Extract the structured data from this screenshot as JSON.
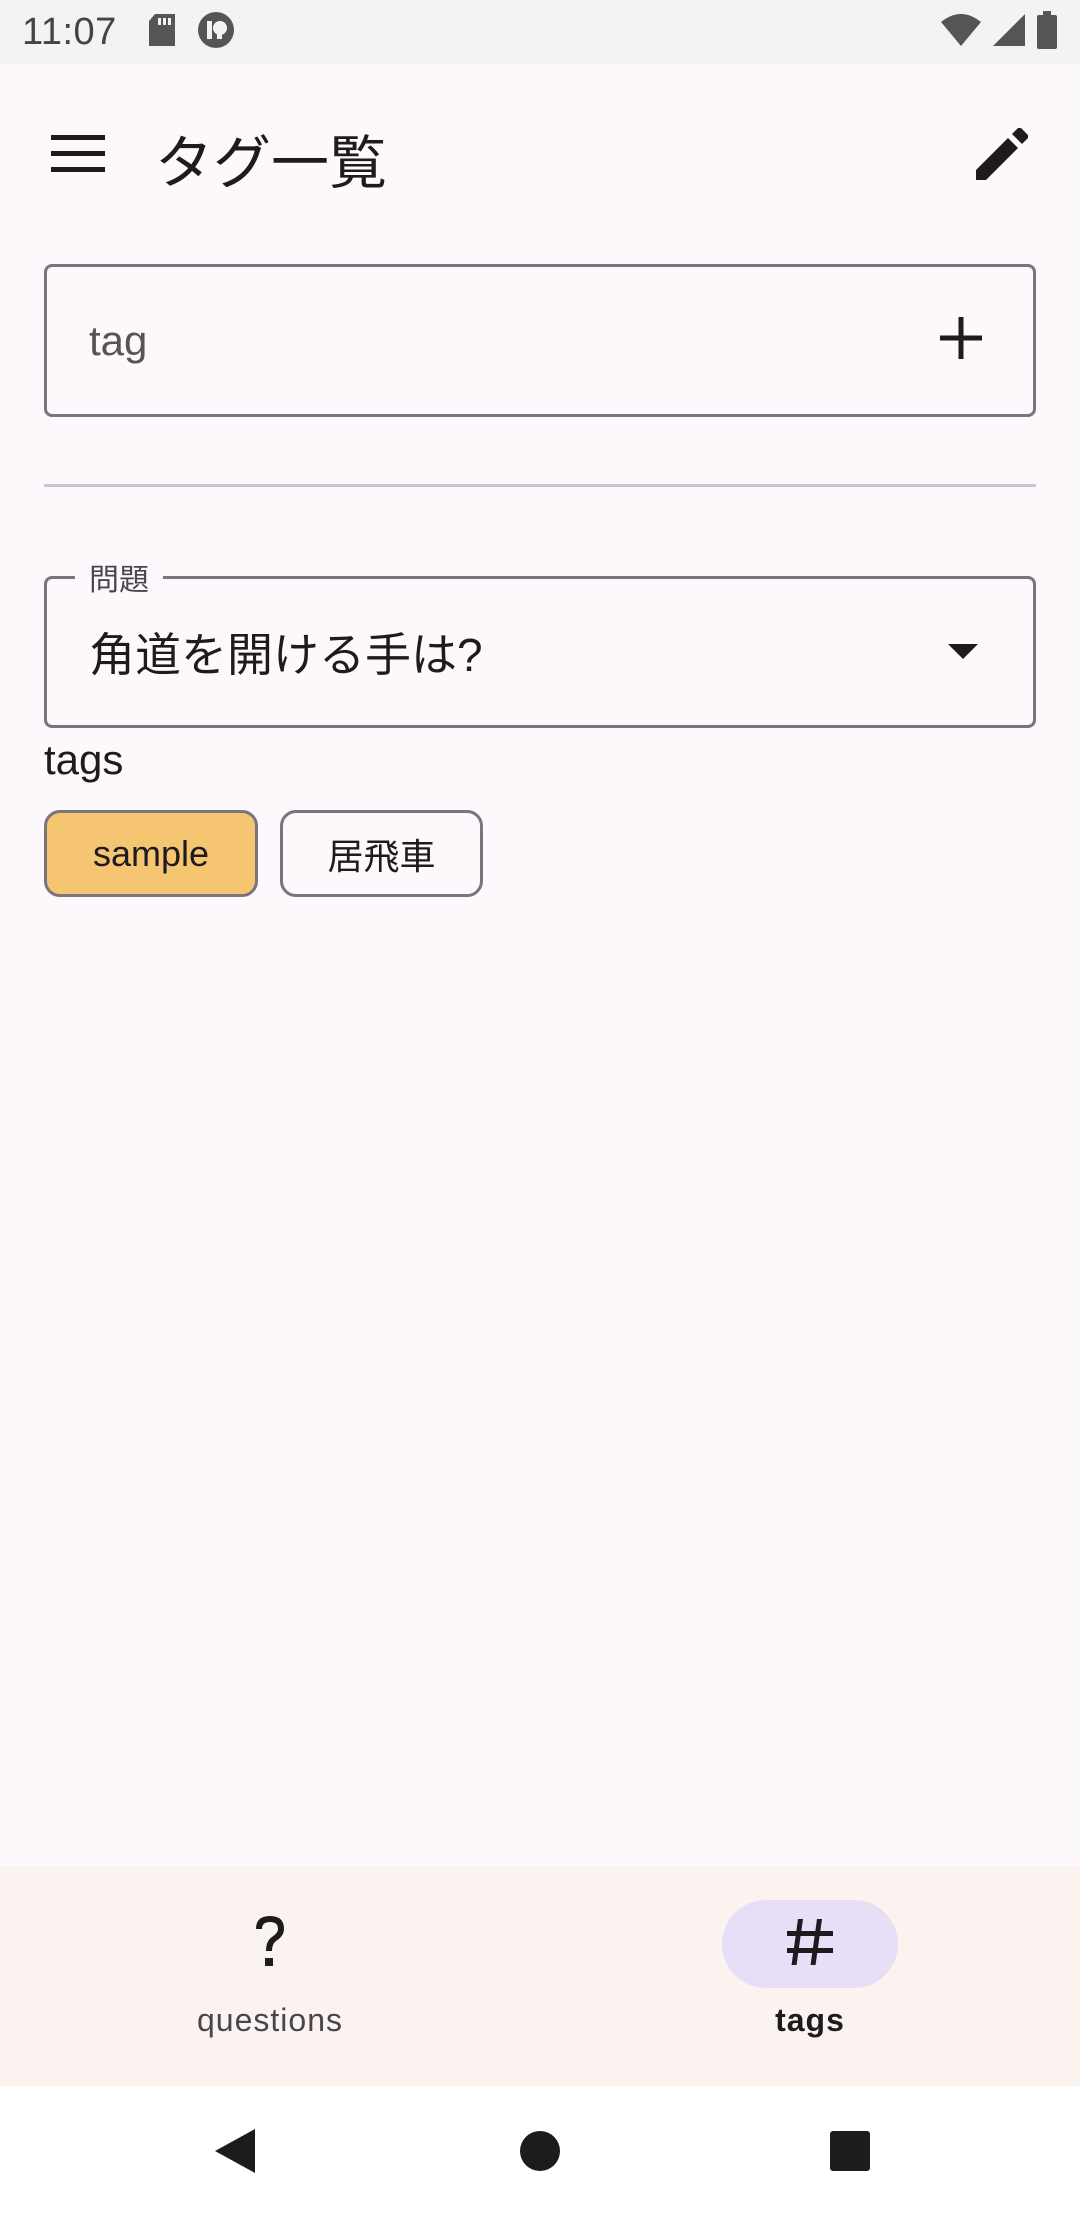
{
  "status_bar": {
    "time": "11:07",
    "icons": [
      "sd-card-icon",
      "app-notification-icon",
      "wifi-icon",
      "cellular-signal-icon",
      "battery-icon"
    ]
  },
  "app_bar": {
    "title": "タグ一覧",
    "menu_icon": "hamburger-menu-icon",
    "edit_icon": "pencil-edit-icon"
  },
  "tag_input": {
    "placeholder": "tag",
    "value": "",
    "add_icon": "plus-icon"
  },
  "question_select": {
    "label": "問題",
    "selected": "角道を開ける手は?",
    "dropdown_icon": "caret-down-icon"
  },
  "tags_section": {
    "label": "tags",
    "chips": [
      {
        "label": "sample",
        "selected": true
      },
      {
        "label": "居飛車",
        "selected": false
      }
    ]
  },
  "bottom_nav": {
    "items": [
      {
        "label": "questions",
        "icon": "question-mark-icon",
        "active": false
      },
      {
        "label": "tags",
        "icon": "hashtag-icon",
        "active": true
      }
    ]
  },
  "colors": {
    "background": "#fdf8fc",
    "selected_chip": "#f6c572",
    "nav_indicator": "#e8def8",
    "bottom_nav_bg": "#fbf3ef",
    "outline": "#79747e"
  }
}
